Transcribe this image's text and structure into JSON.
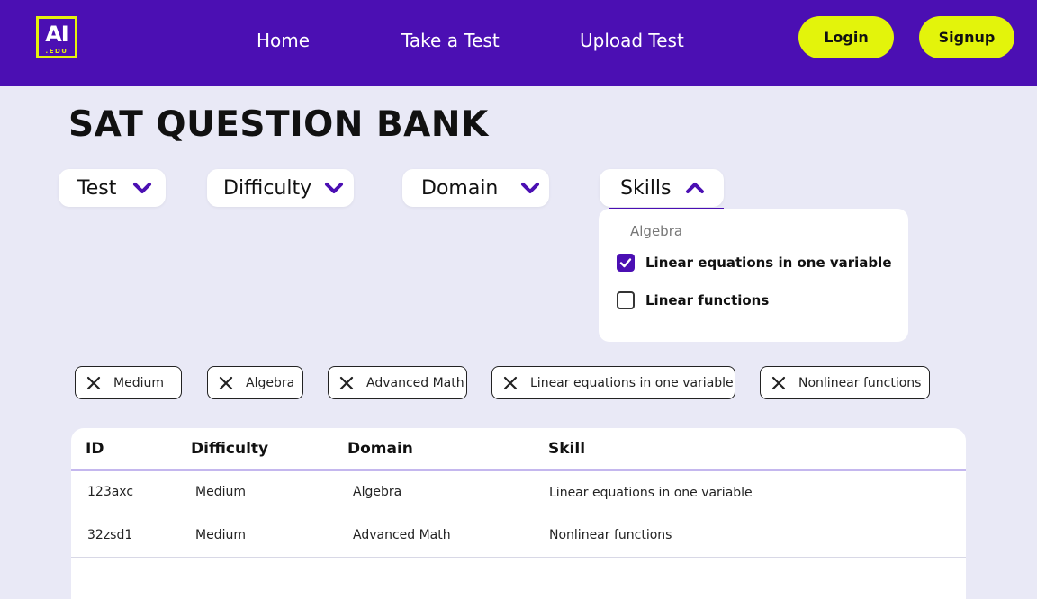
{
  "header": {
    "logo": {
      "main": "AI",
      "sub": ".EDU"
    },
    "nav": [
      {
        "label": "Home"
      },
      {
        "label": "Take a Test"
      },
      {
        "label": "Upload Test"
      }
    ],
    "login_label": "Login",
    "signup_label": "Signup",
    "colors": {
      "bar": "#4b0fb3",
      "accent": "#e3f40b"
    }
  },
  "page": {
    "title": "SAT QUESTION BANK"
  },
  "filters": [
    {
      "label": "Test",
      "expanded": false
    },
    {
      "label": "Difficulty",
      "expanded": false
    },
    {
      "label": "Domain",
      "expanded": false
    },
    {
      "label": "Skills",
      "expanded": true
    }
  ],
  "skills_dropdown": {
    "group": "Algebra",
    "options": [
      {
        "label": "Linear equations in one variable",
        "checked": true
      },
      {
        "label": "Linear functions",
        "checked": false
      }
    ]
  },
  "chips": [
    {
      "label": "Medium"
    },
    {
      "label": "Algebra"
    },
    {
      "label": "Advanced Math"
    },
    {
      "label": "Linear equations in one variable"
    },
    {
      "label": "Nonlinear functions"
    }
  ],
  "table": {
    "columns": [
      "ID",
      "Difficulty",
      "Domain",
      "Skill"
    ],
    "rows": [
      [
        "123axc",
        "Medium",
        "Algebra",
        "Linear equations in one variable"
      ],
      [
        "32zsd1",
        "Medium",
        "Advanced Math",
        "Nonlinear functions"
      ]
    ]
  }
}
